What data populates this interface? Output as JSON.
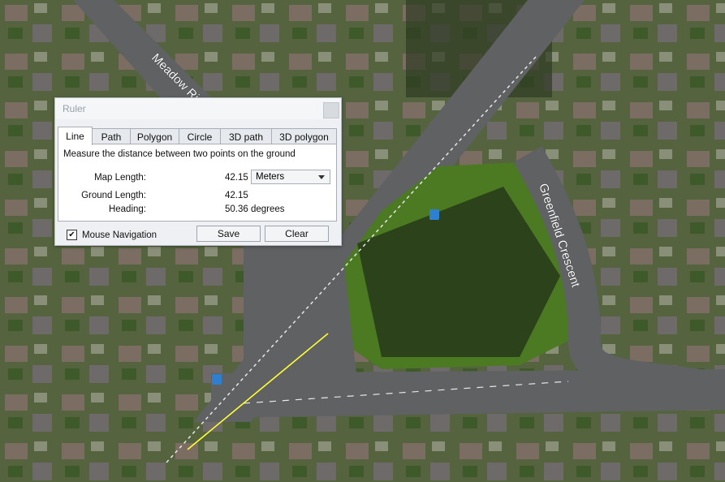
{
  "map": {
    "road_labels": [
      "Meadow Ri",
      "Greenfield Crescent"
    ]
  },
  "ruler": {
    "title": "Ruler",
    "tabs": [
      {
        "label": "Line",
        "active": true
      },
      {
        "label": "Path",
        "active": false
      },
      {
        "label": "Polygon",
        "active": false
      },
      {
        "label": "Circle",
        "active": false
      },
      {
        "label": "3D path",
        "active": false
      },
      {
        "label": "3D polygon",
        "active": false
      }
    ],
    "description": "Measure the distance between two points on the ground",
    "map_length_label": "Map Length:",
    "map_length_value": "42.15",
    "units_selected": "Meters",
    "ground_length_label": "Ground Length:",
    "ground_length_value": "42.15",
    "heading_label": "Heading:",
    "heading_value": "50.36 degrees",
    "mouse_navigation_label": "Mouse Navigation",
    "mouse_navigation_checked": "✔",
    "save_label": "Save",
    "clear_label": "Clear"
  },
  "colors": {
    "measure_line": "#ffff33",
    "dialog_bg": "#eef0f3"
  }
}
